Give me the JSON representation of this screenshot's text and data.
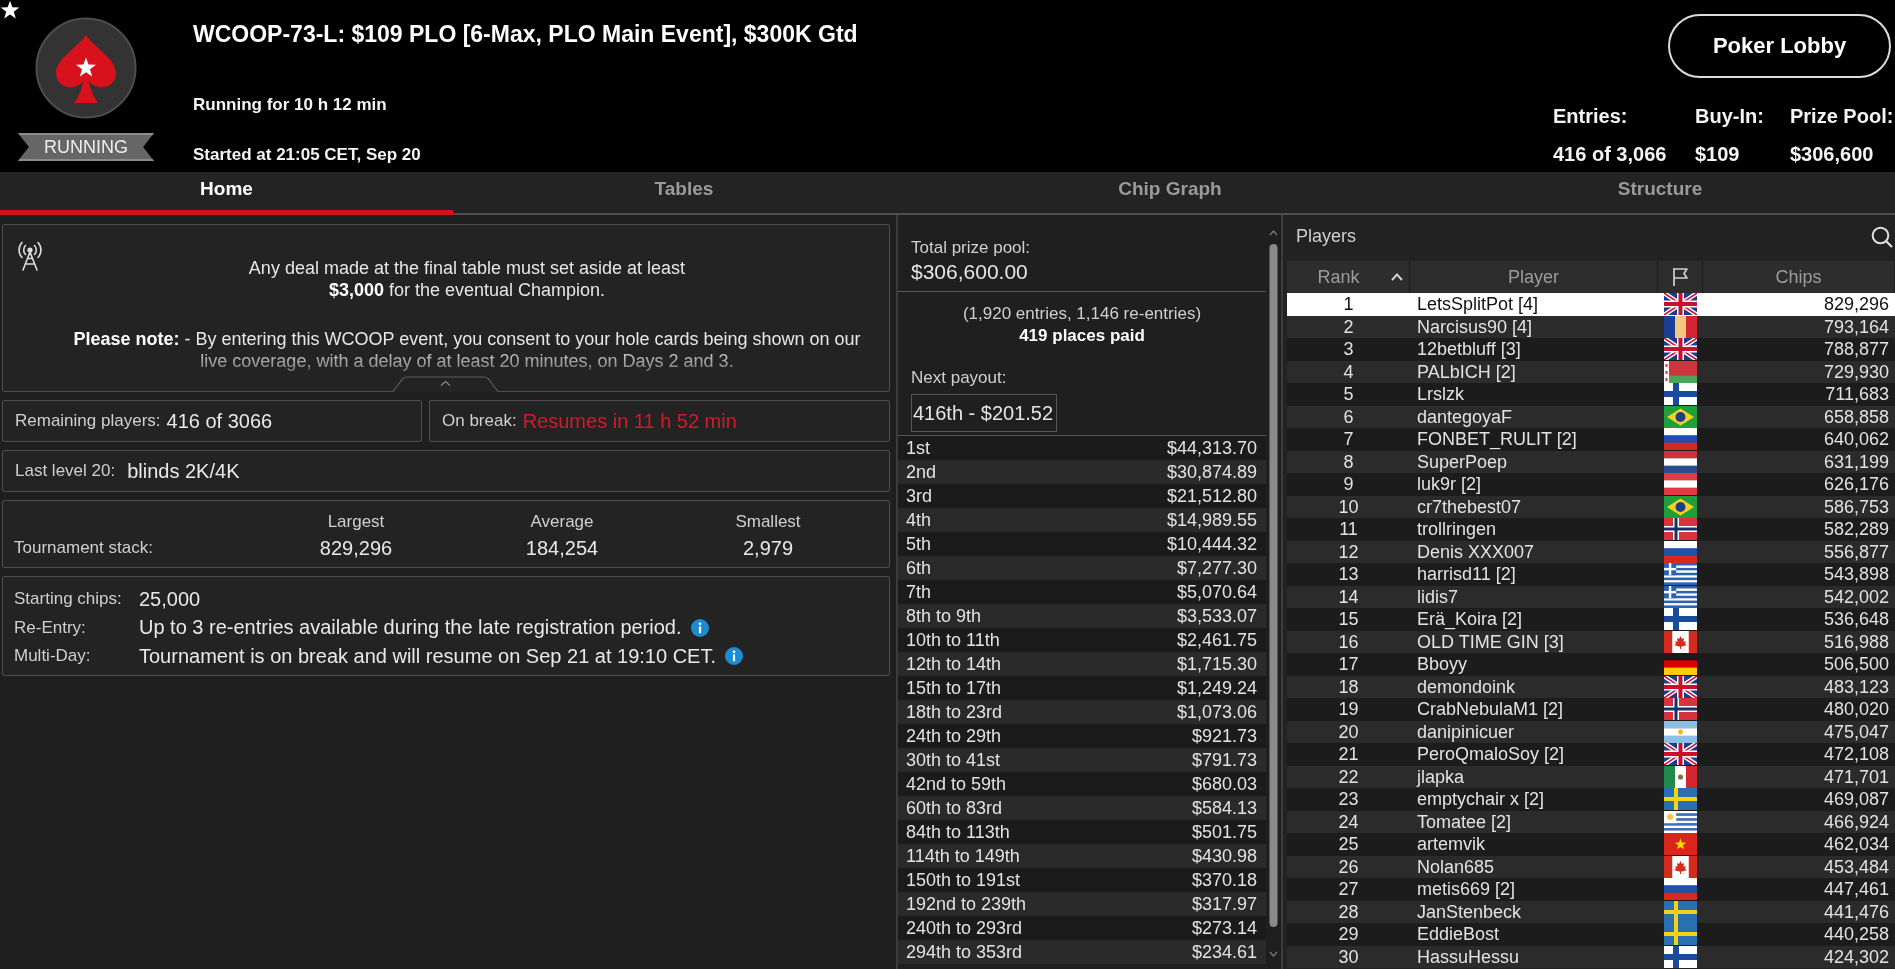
{
  "header": {
    "title": "WCOOP-73-L: $109 PLO [6-Max, PLO Main Event], $300K Gtd",
    "status": "RUNNING",
    "running_for": "Running for 10 h 12 min",
    "started_at": "Started at 21:05 CET, Sep 20",
    "lobby_button": "Poker Lobby",
    "stats": [
      {
        "label": "Entries:",
        "value": "416 of 3,066"
      },
      {
        "label": "Buy-In:",
        "value": "$109"
      },
      {
        "label": "Prize Pool:",
        "value": "$306,600"
      }
    ]
  },
  "tabs": [
    {
      "label": "Home",
      "selected": true
    },
    {
      "label": "Tables",
      "selected": false
    },
    {
      "label": "Chip Graph",
      "selected": false
    },
    {
      "label": "Structure",
      "selected": false
    }
  ],
  "announcement": {
    "paragraphs": [
      [
        "Any deal made at the final table must set aside at least",
        "**$3,000** for the eventual Champion."
      ],
      [
        "**Please note:** - By entering this WCOOP event, you consent to your hole cards being shown on our",
        "live coverage, with a delay of at least 20 minutes, on Days 2 and 3."
      ]
    ]
  },
  "remaining": {
    "label": "Remaining players:",
    "value": "416 of 3066"
  },
  "break_status": {
    "label": "On break:",
    "value": "Resumes in 11 h 52 min"
  },
  "last_level": {
    "label": "Last level 20:",
    "value": "blinds 2K/4K"
  },
  "tournament_stack": {
    "label": "Tournament stack:",
    "columns": [
      {
        "heading": "Largest",
        "value": "829,296"
      },
      {
        "heading": "Average",
        "value": "184,254"
      },
      {
        "heading": "Smallest",
        "value": "2,979"
      }
    ]
  },
  "details": [
    {
      "label": "Starting chips:",
      "value": "25,000",
      "info": false
    },
    {
      "label": "Re-Entry:",
      "value": "Up to 3 re-entries available during the late registration period.",
      "info": true
    },
    {
      "label": "Multi-Day:",
      "value": "Tournament is on break and will resume on Sep 21 at 19:10 CET.",
      "info": true
    }
  ],
  "prizes": {
    "total_label": "Total prize pool:",
    "total": "$306,600.00",
    "entries_note": "(1,920 entries, 1,146 re-entries)",
    "places_paid": "419 places paid",
    "next_label": "Next payout:",
    "next_value": "416th - $201.52",
    "rows": [
      {
        "place": "1st",
        "amount": "$44,313.70"
      },
      {
        "place": "2nd",
        "amount": "$30,874.89"
      },
      {
        "place": "3rd",
        "amount": "$21,512.80"
      },
      {
        "place": "4th",
        "amount": "$14,989.55"
      },
      {
        "place": "5th",
        "amount": "$10,444.32"
      },
      {
        "place": "6th",
        "amount": "$7,277.30"
      },
      {
        "place": "7th",
        "amount": "$5,070.64"
      },
      {
        "place": "8th to 9th",
        "amount": "$3,533.07"
      },
      {
        "place": "10th to 11th",
        "amount": "$2,461.75"
      },
      {
        "place": "12th to 14th",
        "amount": "$1,715.30"
      },
      {
        "place": "15th to 17th",
        "amount": "$1,249.24"
      },
      {
        "place": "18th to 23rd",
        "amount": "$1,073.06"
      },
      {
        "place": "24th to 29th",
        "amount": "$921.73"
      },
      {
        "place": "30th to 41st",
        "amount": "$791.73"
      },
      {
        "place": "42nd to 59th",
        "amount": "$680.03"
      },
      {
        "place": "60th to 83rd",
        "amount": "$584.13"
      },
      {
        "place": "84th to 113th",
        "amount": "$501.75"
      },
      {
        "place": "114th to 149th",
        "amount": "$430.98"
      },
      {
        "place": "150th to 191st",
        "amount": "$370.18"
      },
      {
        "place": "192nd to 239th",
        "amount": "$317.97"
      },
      {
        "place": "240th to 293rd",
        "amount": "$273.14"
      },
      {
        "place": "294th to 353rd",
        "amount": "$234.61"
      }
    ]
  },
  "players": {
    "title": "Players",
    "columns": [
      {
        "kind": "text",
        "label": "Rank",
        "sorted": true
      },
      {
        "kind": "text",
        "label": "Player",
        "sorted": false
      },
      {
        "kind": "flag",
        "sorted": false
      },
      {
        "kind": "text",
        "label": "Chips",
        "sorted": false
      }
    ],
    "rows": [
      {
        "rank": "1",
        "player": "LetsSplitPot [4]",
        "kind": "britain",
        "chips": "829,296",
        "selected": true
      },
      {
        "rank": "2",
        "player": "Narcisus90 [4]",
        "kind": "romania",
        "chips": "793,164",
        "selected": false
      },
      {
        "rank": "3",
        "player": "12betbluff [3]",
        "kind": "britain",
        "chips": "788,877",
        "selected": false
      },
      {
        "rank": "4",
        "player": "PALbICH [2]",
        "kind": "belarus",
        "chips": "729,930",
        "selected": false
      },
      {
        "rank": "5",
        "player": "Lrslzk",
        "kind": "finland",
        "chips": "711,683",
        "selected": false
      },
      {
        "rank": "6",
        "player": "dantegoyaF",
        "kind": "brazil",
        "chips": "658,858",
        "selected": false
      },
      {
        "rank": "7",
        "player": "FONBET_RULIT [2]",
        "kind": "russia",
        "chips": "640,062",
        "selected": false
      },
      {
        "rank": "8",
        "player": "SuperPoep",
        "kind": "netherlands",
        "chips": "631,199",
        "selected": false
      },
      {
        "rank": "9",
        "player": "luk9r [2]",
        "kind": "austria",
        "chips": "626,176",
        "selected": false
      },
      {
        "rank": "10",
        "player": "cr7thebest07",
        "kind": "brazil",
        "chips": "586,753",
        "selected": false
      },
      {
        "rank": "11",
        "player": "trollringen",
        "kind": "norway",
        "chips": "582,289",
        "selected": false
      },
      {
        "rank": "12",
        "player": "Denis XXX007",
        "kind": "russia",
        "chips": "556,877",
        "selected": false
      },
      {
        "rank": "13",
        "player": "harrisd11 [2]",
        "kind": "greece",
        "chips": "543,898",
        "selected": false
      },
      {
        "rank": "14",
        "player": "lidis7",
        "kind": "greece",
        "chips": "542,002",
        "selected": false
      },
      {
        "rank": "15",
        "player": "Erä_Koira [2]",
        "kind": "finland",
        "chips": "536,648",
        "selected": false
      },
      {
        "rank": "16",
        "player": "OLD TIME GIN [3]",
        "kind": "canada",
        "chips": "516,988",
        "selected": false
      },
      {
        "rank": "17",
        "player": "Bboyy",
        "kind": "germany",
        "chips": "506,500",
        "selected": false
      },
      {
        "rank": "18",
        "player": "demondoink",
        "kind": "britain",
        "chips": "483,123",
        "selected": false
      },
      {
        "rank": "19",
        "player": "CrabNebulaM1 [2]",
        "kind": "norway",
        "chips": "480,020",
        "selected": false
      },
      {
        "rank": "20",
        "player": "danipinicuer",
        "kind": "argentina",
        "chips": "475,047",
        "selected": false
      },
      {
        "rank": "21",
        "player": "PeroQmaloSoy [2]",
        "kind": "britain",
        "chips": "472,108",
        "selected": false
      },
      {
        "rank": "22",
        "player": "jlapka",
        "kind": "mexico",
        "chips": "471,701",
        "selected": false
      },
      {
        "rank": "23",
        "player": "emptychair x [2]",
        "kind": "sweden",
        "chips": "469,087",
        "selected": false
      },
      {
        "rank": "24",
        "player": "Tomatee [2]",
        "kind": "uruguay",
        "chips": "466,924",
        "selected": false
      },
      {
        "rank": "25",
        "player": "artemvik",
        "kind": "vietnam",
        "chips": "462,034",
        "selected": false
      },
      {
        "rank": "26",
        "player": "Nolan685",
        "kind": "canada",
        "chips": "453,484",
        "selected": false
      },
      {
        "rank": "27",
        "player": "metis669 [2]",
        "kind": "russia",
        "chips": "447,461",
        "selected": false
      },
      {
        "rank": "28",
        "player": "JanStenbeck",
        "kind": "sweden",
        "chips": "441,476",
        "selected": false
      },
      {
        "rank": "29",
        "player": "EddieBost",
        "kind": "sweden",
        "chips": "440,258",
        "selected": false
      },
      {
        "rank": "30",
        "player": "HassuHessu",
        "kind": "finland",
        "chips": "424,302",
        "selected": false
      }
    ]
  }
}
